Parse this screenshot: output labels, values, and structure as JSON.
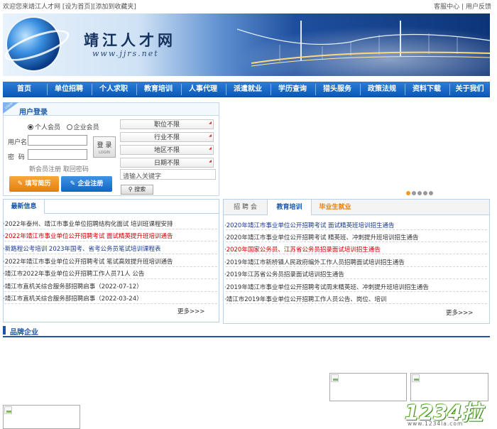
{
  "topbar": {
    "welcome": "欢迎您来靖江人才网",
    "set_home": "[设为首页]",
    "add_fav": "[添加到收藏夹]",
    "service": "客服中心",
    "sep": "|",
    "feedback": "用户反馈"
  },
  "banner": {
    "logo_text": "靖江人才网",
    "logo_url": "www.jjrs.net"
  },
  "nav": {
    "items": [
      "首页",
      "单位招聘",
      "个人求职",
      "教育培训",
      "人事代理",
      "派遣就业",
      "学历查询",
      "猎头服务",
      "政策法规",
      "资料下载",
      "关于我们"
    ]
  },
  "login": {
    "title": "用户登录",
    "corner_badge": "LOGIN",
    "radio_personal": "个人会员",
    "radio_company": "企业会员",
    "username_label": "用户名",
    "password_label": "密  码",
    "login_button": "登 录",
    "login_button_sub": "LOGIN",
    "register_link": "新会员注册",
    "forgot_link": "取回密码",
    "fill_resume": "填写简历",
    "company_register": "企业注册"
  },
  "filters": {
    "position": "职位不限",
    "industry": "行业不限",
    "region": "地区不限",
    "date": "日期不限",
    "keyword_placeholder": "请输入关键字",
    "search_button": "搜索"
  },
  "latest": {
    "tab": "最新信息",
    "more": "更多>>>",
    "items": [
      {
        "text": "·2022年泰州、靖江市事业单位招聘结构化面试 培训班课程安排",
        "color": "#333333"
      },
      {
        "text": "·2022年靖江市事业单位公开招聘考试 面试精英提升班培训通告",
        "color": "#cc0000"
      },
      {
        "text": "·新路程公考培训 2023年国考、省考公务员笔试培训课程表",
        "color": "#1a3c8c"
      },
      {
        "text": "·2022年靖江市事业单位公开招聘考试 笔试高效提升班培训通告",
        "color": "#333333"
      },
      {
        "text": "·靖江市2022年事业单位公开招聘工作人员71人 公告",
        "color": "#333333"
      },
      {
        "text": "·靖江市直机关综合服务部招聘启事（2022-07-12）",
        "color": "#333333"
      },
      {
        "text": "·靖江市直机关综合服务部招聘启事（2022-03-24）",
        "color": "#333333"
      }
    ]
  },
  "training": {
    "tabs": [
      "招 聘 会",
      "教育培训",
      "毕业生就业"
    ],
    "more": "更多>>>",
    "items": [
      {
        "text": "·2020年靖江市事业单位公开招聘考试 面试精英班培训招生通告",
        "color": "#1a3c8c"
      },
      {
        "text": "·2020年靖江市事业单位公开招聘考试 精英班、冲刺提升班培训招生通告",
        "color": "#333333"
      },
      {
        "text": "·2020年国家公务员、江苏省公务员招录面试培训招生通告",
        "color": "#cc0000"
      },
      {
        "text": "·2019年靖江市新桥镇人民政府编外工作人员招聘面试培训招生通告",
        "color": "#333333"
      },
      {
        "text": "·2019年江苏省公务员招录面试培训招生通告",
        "color": "#333333"
      },
      {
        "text": "·2019年靖江市事业单位公开招聘考试周末精英班、冲刺提升班培训招生通告",
        "color": "#333333"
      },
      {
        "text": "·靖江市2019年事业单位公开招聘工作人员公告、岗位、培训",
        "color": "#333333"
      }
    ]
  },
  "brand": {
    "title": "品牌企业"
  },
  "watermark": {
    "num": "1234",
    "char": "拉",
    "url": "www.1234la.com"
  },
  "colors": {
    "nav_blue": "#0b59b8",
    "accent_orange": "#f29a20",
    "link_blue": "#1a56a7",
    "alert_red": "#cc0000"
  }
}
